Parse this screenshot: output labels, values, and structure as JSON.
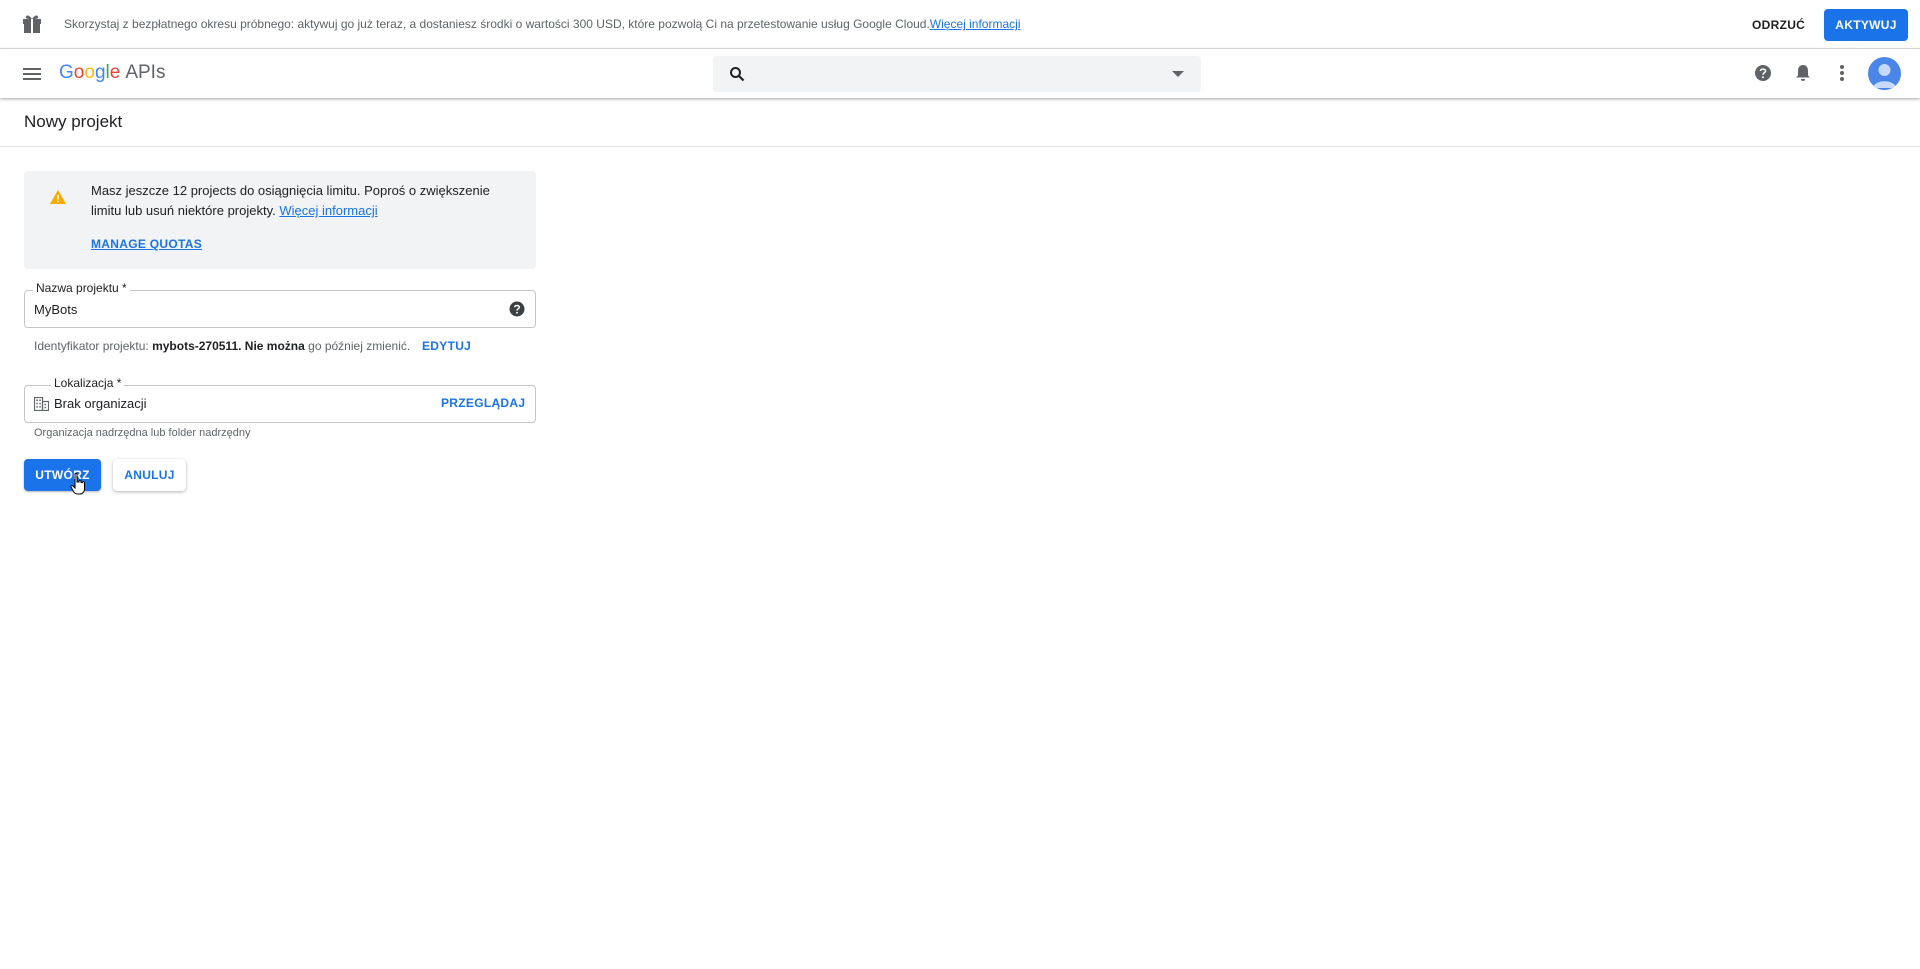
{
  "promo": {
    "text": "Skorzystaj z bezpłatnego okresu próbnego: aktywuj go już teraz, a dostaniesz środki o wartości 300 USD, które pozwolą Ci na przetestowanie usług Google Cloud.",
    "link": "Więcej informacji",
    "dismiss_label": "ODRZUĆ",
    "activate_label": "AKTYWUJ"
  },
  "header": {
    "logo_g": [
      "G",
      "o",
      "o",
      "g",
      "l",
      "e"
    ],
    "logo_suffix": "APIs",
    "search_value": ""
  },
  "page": {
    "title": "Nowy projekt"
  },
  "quota": {
    "text": "Masz jeszcze 12 projects do osiągnięcia limitu. Poproś o zwiększenie limitu lub usuń niektóre projekty.",
    "link": "Więcej informacji",
    "manage_label": "MANAGE QUOTAS"
  },
  "form": {
    "name_label": "Nazwa projektu *",
    "name_value": "MyBots",
    "id_prefix": "Identyfikator projektu: ",
    "id_value": "mybots-270511",
    "id_cannot": ". Nie można",
    "id_suffix": " go później zmienić.",
    "edit_label": "EDYTUJ",
    "location_label": "Lokalizacja *",
    "location_value": "Brak organizacji",
    "browse_label": "PRZEGLĄDAJ",
    "location_hint": "Organizacja nadrzędna lub folder nadrzędny"
  },
  "actions": {
    "create_label": "UTWÓRZ",
    "cancel_label": "ANULUJ"
  },
  "colors": {
    "accent": "#1a73e8",
    "warning": "#f9ab00"
  }
}
